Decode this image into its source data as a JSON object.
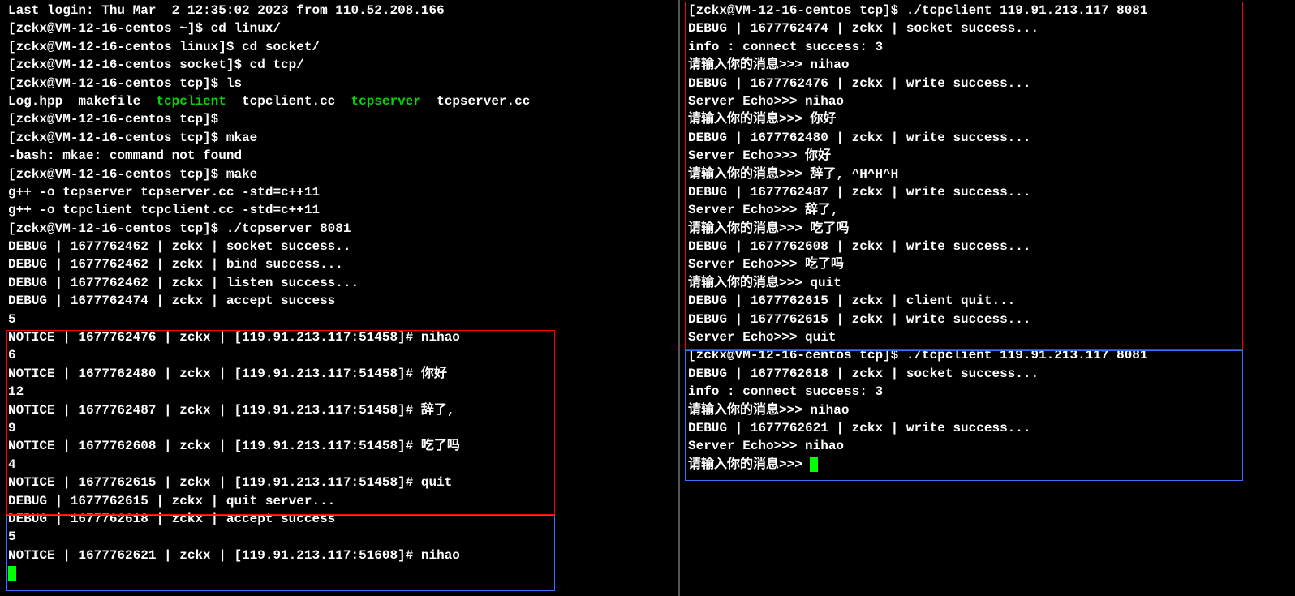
{
  "left": {
    "l0": "Last login: Thu Mar  2 12:35:02 2023 from 110.52.208.166",
    "l1": "[zckx@VM-12-16-centos ~]$ cd linux/",
    "l2": "[zckx@VM-12-16-centos linux]$ cd socket/",
    "l3": "[zckx@VM-12-16-centos socket]$ cd tcp/",
    "l4": "[zckx@VM-12-16-centos tcp]$ ls",
    "l5a": "Log.hpp  makefile  ",
    "l5b": "tcpclient",
    "l5c": "  tcpclient.cc  ",
    "l5d": "tcpserver",
    "l5e": "  tcpserver.cc",
    "l6": "[zckx@VM-12-16-centos tcp]$",
    "l7": "[zckx@VM-12-16-centos tcp]$ mkae",
    "l8": "-bash: mkae: command not found",
    "l9": "[zckx@VM-12-16-centos tcp]$ make",
    "l10": "g++ -o tcpserver tcpserver.cc -std=c++11",
    "l11": "g++ -o tcpclient tcpclient.cc -std=c++11",
    "l12": "[zckx@VM-12-16-centos tcp]$ ./tcpserver 8081",
    "l13": "DEBUG | 1677762462 | zckx | socket success..",
    "l14": "DEBUG | 1677762462 | zckx | bind success...",
    "l15": "DEBUG | 1677762462 | zckx | listen success...",
    "l16": "DEBUG | 1677762474 | zckx | accept success",
    "l17": "5",
    "l18": "NOTICE | 1677762476 | zckx | [119.91.213.117:51458]# nihao",
    "l19": "6",
    "l20": "NOTICE | 1677762480 | zckx | [119.91.213.117:51458]# 你好",
    "l21": "12",
    "l22": "NOTICE | 1677762487 | zckx | [119.91.213.117:51458]# 辞了,",
    "l23": "9",
    "l24": "NOTICE | 1677762608 | zckx | [119.91.213.117:51458]# 吃了吗",
    "l25": "4",
    "l26": "NOTICE | 1677762615 | zckx | [119.91.213.117:51458]# quit",
    "l27": "DEBUG | 1677762615 | zckx | quit server...",
    "l28": "DEBUG | 1677762618 | zckx | accept success",
    "l29": "5",
    "l30": "NOTICE | 1677762621 | zckx | [119.91.213.117:51608]# nihao"
  },
  "right": {
    "r0": "[zckx@VM-12-16-centos tcp]$ ./tcpclient 119.91.213.117 8081",
    "r1": "DEBUG | 1677762474 | zckx | socket success...",
    "r2": "info : connect success: 3",
    "r3": "请输入你的消息>>> nihao",
    "r4": "DEBUG | 1677762476 | zckx | write success...",
    "r5": "Server Echo>>> nihao",
    "r6": "请输入你的消息>>> 你好",
    "r7": "DEBUG | 1677762480 | zckx | write success...",
    "r8": "Server Echo>>> 你好",
    "r9": "请输入你的消息>>> 辞了, ^H^H^H",
    "r10": "DEBUG | 1677762487 | zckx | write success...",
    "r11": "Server Echo>>> 辞了,",
    "r12": "请输入你的消息>>> 吃了吗",
    "r13": "DEBUG | 1677762608 | zckx | write success...",
    "r14": "Server Echo>>> 吃了吗",
    "r15": "请输入你的消息>>> quit",
    "r16": "DEBUG | 1677762615 | zckx | client quit...",
    "r17": "DEBUG | 1677762615 | zckx | write success...",
    "r18": "Server Echo>>> quit",
    "r19": "[zckx@VM-12-16-centos tcp]$ ./tcpclient 119.91.213.117 8081",
    "r20": "DEBUG | 1677762618 | zckx | socket success...",
    "r21": "info : connect success: 3",
    "r22": "请输入你的消息>>> nihao",
    "r23": "DEBUG | 1677762621 | zckx | write success...",
    "r24": "Server Echo>>> nihao",
    "r25": "请输入你的消息>>> "
  }
}
